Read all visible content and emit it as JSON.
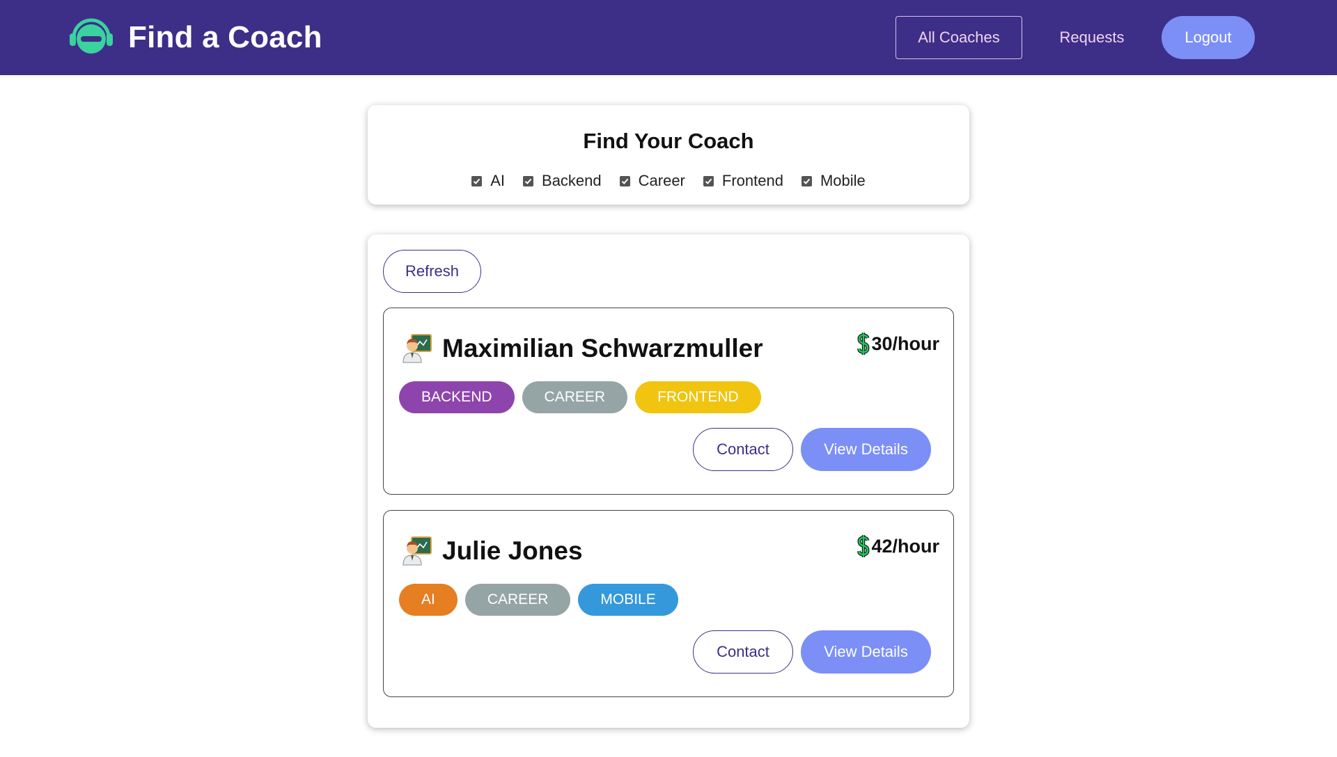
{
  "header": {
    "brand_title": "Find a Coach",
    "logo_icon": "headset-robot-logo-icon",
    "nav": {
      "all_coaches": "All Coaches",
      "requests": "Requests",
      "logout": "Logout"
    }
  },
  "filter": {
    "title": "Find Your Coach",
    "options": [
      {
        "label": "AI",
        "checked": true
      },
      {
        "label": "Backend",
        "checked": true
      },
      {
        "label": "Career",
        "checked": true
      },
      {
        "label": "Frontend",
        "checked": true
      },
      {
        "label": "Mobile",
        "checked": true
      }
    ]
  },
  "list": {
    "refresh_label": "Refresh",
    "coaches": [
      {
        "name": "Maximilian Schwarzmuller",
        "rate": "30/hour",
        "avatar_icon": "teacher-icon",
        "tags": [
          {
            "label": "BACKEND",
            "color": "#8e44ad"
          },
          {
            "label": "CAREER",
            "color": "#95a5a6"
          },
          {
            "label": "FRONTEND",
            "color": "#f1c40f"
          }
        ],
        "contact_label": "Contact",
        "details_label": "View Details"
      },
      {
        "name": "Julie Jones",
        "rate": "42/hour",
        "avatar_icon": "teacher-icon",
        "tags": [
          {
            "label": "AI",
            "color": "#e67e22"
          },
          {
            "label": "CAREER",
            "color": "#95a5a6"
          },
          {
            "label": "MOBILE",
            "color": "#3498db"
          }
        ],
        "contact_label": "Contact",
        "details_label": "View Details"
      }
    ]
  },
  "colors": {
    "header_bg": "#3d2e87",
    "accent": "#7b8ff7",
    "logo": "#3ad29f"
  }
}
